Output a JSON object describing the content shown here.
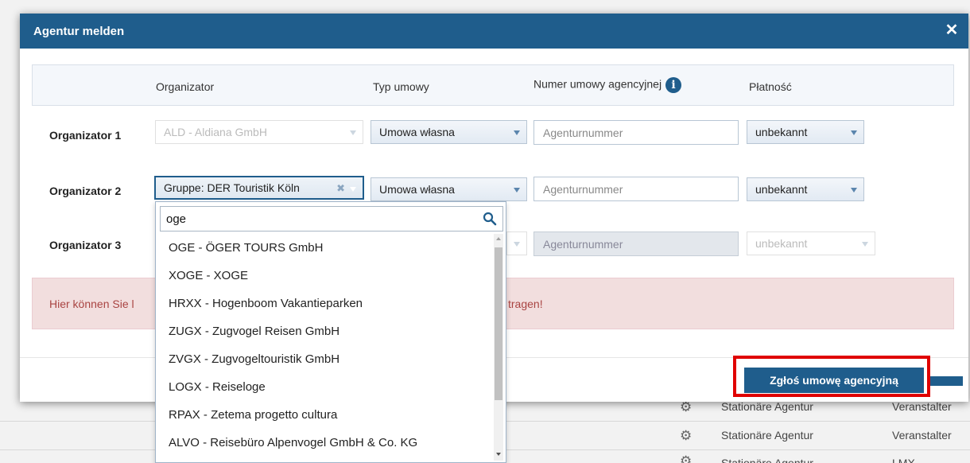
{
  "background": {
    "rows": [
      {
        "type": "Stationäre Agentur",
        "kind": "Veranstalter"
      },
      {
        "type": "Stationäre Agentur",
        "kind": "Veranstalter"
      },
      {
        "type": "Stationäre Agentur",
        "kind": "LMX"
      }
    ]
  },
  "modal": {
    "title": "Agentur melden",
    "columns": {
      "organizer": "Organizator",
      "contract_type": "Typ umowy",
      "agency_number": "Numer umowy agencyjnej",
      "payment": "Płatność"
    },
    "rows": [
      {
        "label": "Organizator 1",
        "organizer": "ALD - Aldiana GmbH",
        "contract_type": "Umowa własna",
        "agency_number_placeholder": "Agenturnummer",
        "payment": "unbekannt"
      },
      {
        "label": "Organizator 2",
        "organizer": "Gruppe: DER Touristik Köln",
        "contract_type": "Umowa własna",
        "agency_number_placeholder": "Agenturnummer",
        "payment": "unbekannt"
      },
      {
        "label": "Organizator 3",
        "organizer": "",
        "contract_type": "",
        "agency_number_placeholder": "Agenturnummer",
        "payment": "unbekannt"
      }
    ],
    "alert_left": "Hier können Sie l",
    "alert_right": "tragen!",
    "submit_label": "Zgłoś umowę agencyjną"
  },
  "dropdown": {
    "search_value": "oge",
    "items": [
      "OGE - ÖGER TOURS GmbH",
      "XOGE - XOGE",
      "HRXX - Hogenboom Vakantieparken",
      "ZUGX - Zugvogel Reisen GmbH",
      "ZVGX - Zugvogeltouristik GmbH",
      "LOGX - Reiseloge",
      "RPAX - Zetema progetto cultura",
      "ALVO - Reisebüro Alpenvogel GmbH & Co. KG"
    ]
  }
}
